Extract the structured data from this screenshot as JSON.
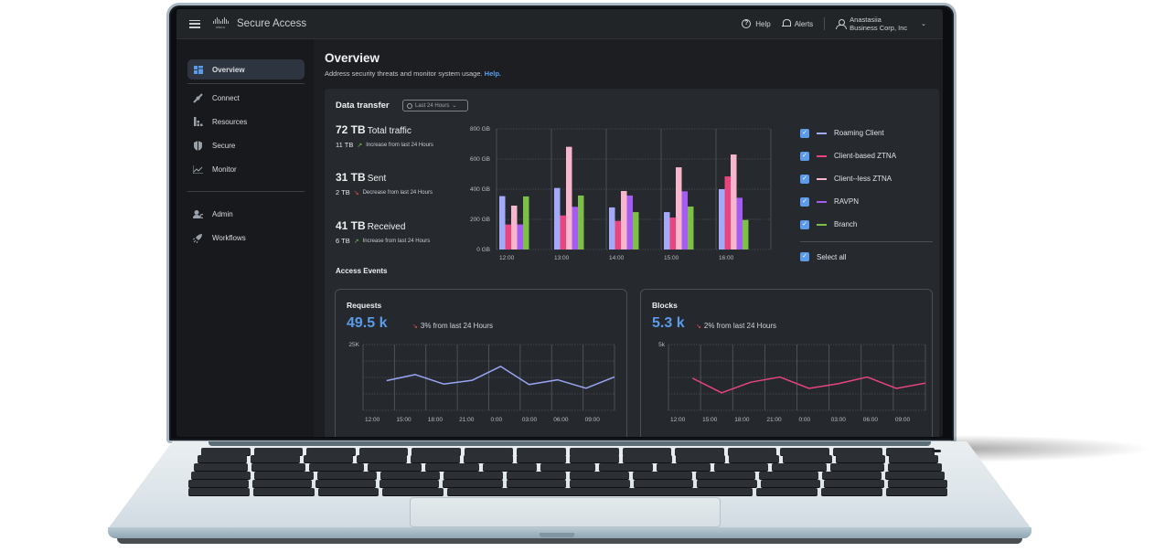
{
  "app": {
    "title": "Secure Access",
    "brand": "cisco"
  },
  "topbar": {
    "help_label": "Help",
    "alerts_label": "Alerts",
    "user_name": "Anastasiia",
    "user_org": "Business Corp, Inc",
    "help_icon": "question-circle-icon",
    "alerts_icon": "bell-icon",
    "user_icon": "user-icon"
  },
  "sidebar": {
    "items": [
      {
        "label": "Overview",
        "icon": "dashboard-icon",
        "active": true
      },
      {
        "label": "Connect",
        "icon": "plug-icon"
      },
      {
        "label": "Resources",
        "icon": "resources-icon"
      },
      {
        "label": "Secure",
        "icon": "shield-icon"
      },
      {
        "label": "Monitor",
        "icon": "chart-line-icon"
      },
      {
        "label": "Admin",
        "icon": "admin-gear-icon"
      },
      {
        "label": "Workflows",
        "icon": "rocket-icon"
      }
    ]
  },
  "page": {
    "title": "Overview",
    "subtitle": "Address security threats and monitor system usage.",
    "help_link": "Help."
  },
  "data_transfer": {
    "title": "Data transfer",
    "range": "Last 24 Hours",
    "stats": [
      {
        "value": "72 TB",
        "label": "Total traffic",
        "delta": "11 TB",
        "trend": "up",
        "desc": "Increase from last 24 Hours"
      },
      {
        "value": "31 TB",
        "label": "Sent",
        "delta": "2 TB",
        "trend": "down",
        "desc": "Decrease from last 24 Hours"
      },
      {
        "value": "41 TB",
        "label": "Received",
        "delta": "6 TB",
        "trend": "up",
        "desc": "Increase from last 24 Hours"
      }
    ],
    "legend": {
      "select_all": "Select all"
    }
  },
  "access_events": {
    "title": "Access Events",
    "requests": {
      "title": "Requests",
      "value": "49.5 k",
      "delta": "3% from last 24 Hours",
      "trend": "down",
      "color": "#9aa6f5"
    },
    "blocks": {
      "title": "Blocks",
      "value": "5.3 k",
      "delta": "2% from last 24 Hours",
      "trend": "down",
      "color": "#e8457f"
    }
  },
  "colors": {
    "accent": "#5b9bea",
    "trend_up": "#6cc04a",
    "trend_down": "#e85a4f"
  },
  "chart_data": [
    {
      "type": "bar",
      "title": "Data transfer",
      "categories": [
        "12:00",
        "13:00",
        "14:00",
        "15:00",
        "16:00"
      ],
      "ylabel": "",
      "yticks": [
        "0 GB",
        "200 GB",
        "400 GB",
        "600 GB",
        "800 GB"
      ],
      "ylim": [
        0,
        800
      ],
      "unit": "GB",
      "grid": true,
      "legend": "right",
      "series": [
        {
          "name": "Roaming Client",
          "color": "#a3aaf8",
          "checked": true,
          "values": [
            354,
            408,
            279,
            248,
            400
          ]
        },
        {
          "name": "Client-based ZTNA",
          "color": "#e8457f",
          "checked": true,
          "values": [
            166,
            226,
            190,
            212,
            485
          ]
        },
        {
          "name": "Client--less ZTNA",
          "color": "#f7b6cb",
          "checked": true,
          "values": [
            291,
            681,
            388,
            545,
            630
          ]
        },
        {
          "name": "RAVPN",
          "color": "#a45df0",
          "checked": true,
          "values": [
            166,
            283,
            358,
            386,
            343
          ]
        },
        {
          "name": "Branch",
          "color": "#7cc04a",
          "checked": true,
          "values": [
            352,
            358,
            248,
            285,
            196
          ]
        }
      ]
    },
    {
      "type": "line",
      "title": "Requests",
      "x": [
        "12:00",
        "15:00",
        "18:00",
        "21:00",
        "0:00",
        "03:00",
        "06:00",
        "09:00"
      ],
      "ytick_top": "25K",
      "ylim": [
        0,
        25000
      ],
      "grid": true,
      "series": [
        {
          "name": "Requests",
          "color": "#9aa6f5",
          "values": [
            11300,
            13600,
            10000,
            11400,
            16700,
            9800,
            11600,
            8400,
            12700
          ]
        }
      ]
    },
    {
      "type": "line",
      "title": "Blocks",
      "x": [
        "12:00",
        "15:00",
        "18:00",
        "21:00",
        "0:00",
        "03:00",
        "06:00",
        "09:00"
      ],
      "ytick_top": "5k",
      "ylim": [
        0,
        5000
      ],
      "grid": true,
      "series": [
        {
          "name": "Blocks",
          "color": "#e8457f",
          "values": [
            2440,
            1330,
            2140,
            2530,
            1670,
            2020,
            2530,
            1670,
            2070
          ]
        }
      ]
    }
  ]
}
